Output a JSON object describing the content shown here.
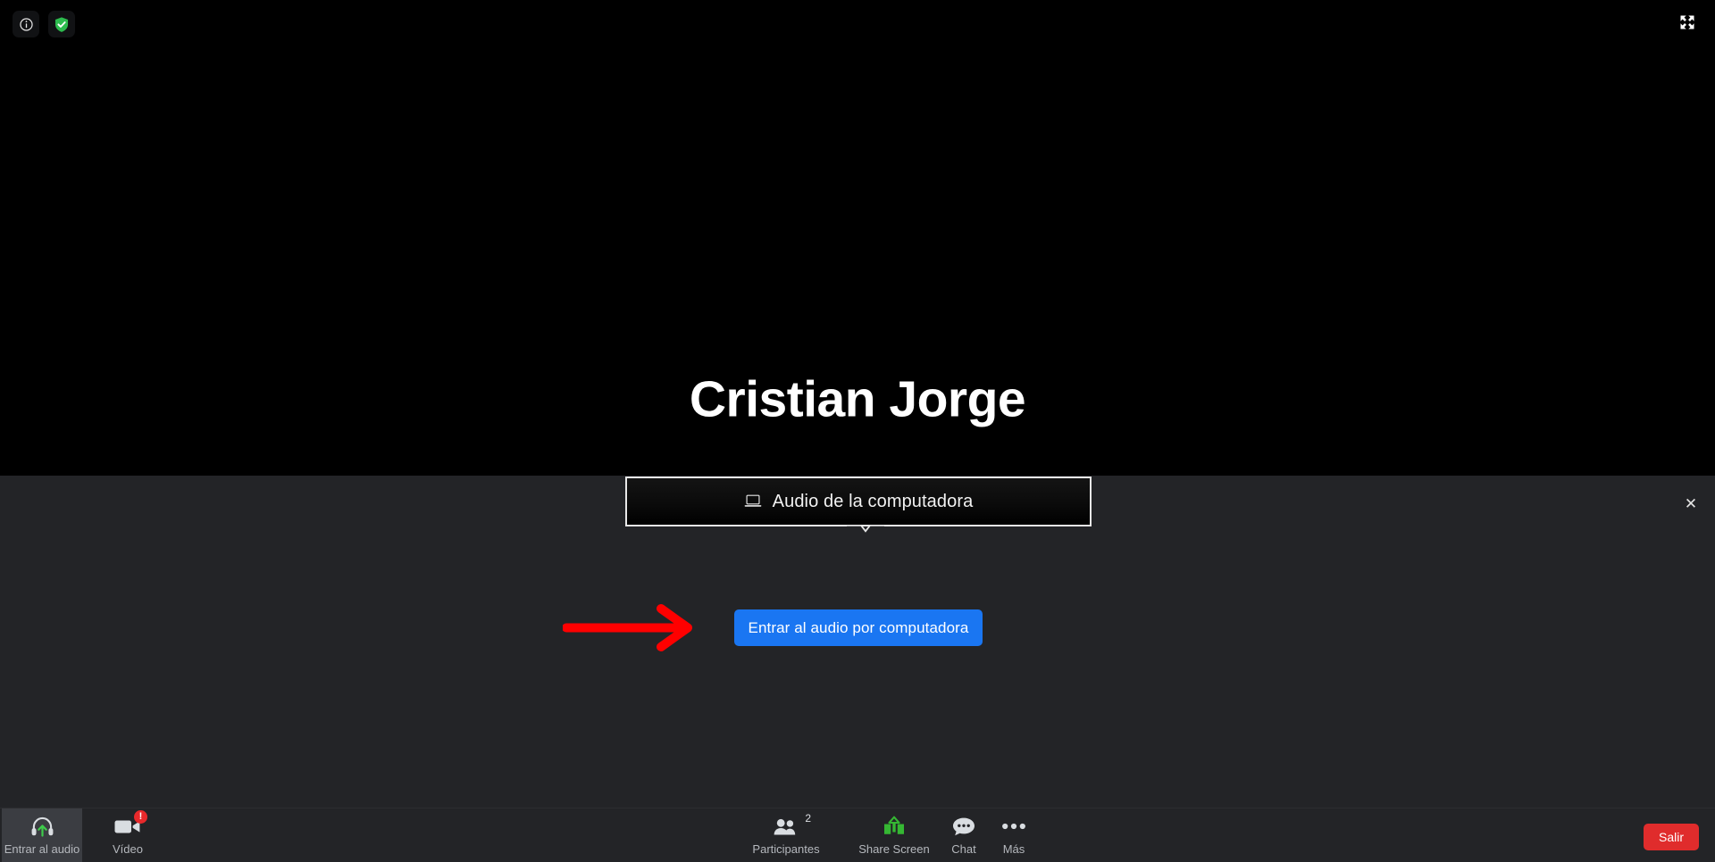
{
  "meeting": {
    "participant_name": "Cristian Jorge"
  },
  "top_bar": {
    "info_icon": "info-circle-icon",
    "encryption_icon": "shield-check-icon",
    "fullscreen_icon": "fullscreen-expand-icon"
  },
  "audio_popup": {
    "label": "Audio de la computadora",
    "icon": "laptop-icon",
    "close_label": "✕"
  },
  "cta": {
    "join_audio_label": "Entrar al audio por computadora"
  },
  "annotation": {
    "arrow_color": "#FF0000",
    "arrow_icon": "right-arrow-annotation"
  },
  "toolbar": {
    "items": [
      {
        "label": "Entrar al audio",
        "icon": "headset-join-audio-icon"
      },
      {
        "label": "Vídeo",
        "icon": "video-camera-icon",
        "badge": "!"
      },
      {
        "label": "Participantes",
        "icon": "participants-icon",
        "count": "2"
      },
      {
        "label": "Share Screen",
        "icon": "share-screen-icon"
      },
      {
        "label": "Chat",
        "icon": "chat-bubble-icon"
      },
      {
        "label": "Más",
        "icon": "more-dots-icon"
      }
    ],
    "leave_label": "Salir"
  },
  "colors": {
    "accent_blue": "#1a76f2",
    "leave_red": "#e02c2c",
    "share_green": "#35b733",
    "shield_green": "#2dbb4e",
    "panel_bg": "#232427",
    "stage_bg": "#000000"
  }
}
